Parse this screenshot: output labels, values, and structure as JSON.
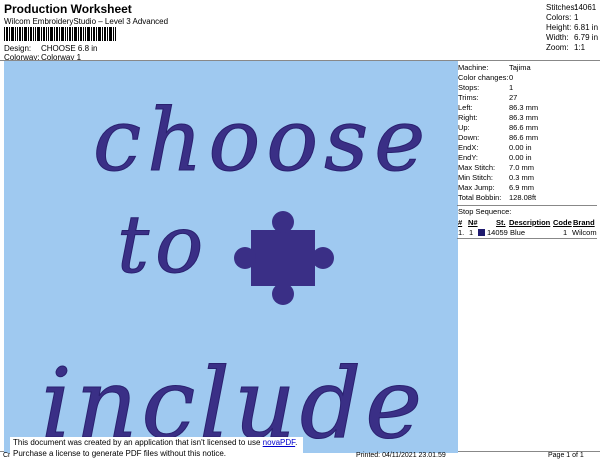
{
  "header": {
    "title": "Production Worksheet",
    "software": "Wilcom EmbroideryStudio – Level 3 Advanced",
    "design_label": "Design:",
    "design_value": "CHOOSE 6.8 in",
    "colorway_label": "Colorway:",
    "colorway_value": "Colorway 1"
  },
  "summary": [
    {
      "label": "Stitches:",
      "value": "14061"
    },
    {
      "label": "Colors:",
      "value": "1"
    },
    {
      "label": "Height:",
      "value": "6.81 in"
    },
    {
      "label": "Width:",
      "value": "6.79 in"
    },
    {
      "label": "Zoom:",
      "value": "1:1"
    }
  ],
  "design_text": {
    "line1": "choose",
    "line2": "to",
    "line3": "include"
  },
  "colors": {
    "canvas": "#9fc9f0",
    "thread": "#3a2f86"
  },
  "details": [
    {
      "label": "Machine:",
      "value": "Tajima"
    },
    {
      "label": "Color changes:",
      "value": "0"
    },
    {
      "label": "Stops:",
      "value": "1"
    },
    {
      "label": "Trims:",
      "value": "27"
    },
    {
      "label": "Left:",
      "value": "86.3 mm"
    },
    {
      "label": "Right:",
      "value": "86.3 mm"
    },
    {
      "label": "Up:",
      "value": "86.6 mm"
    },
    {
      "label": "Down:",
      "value": "86.6 mm"
    },
    {
      "label": "EndX:",
      "value": "0.00 in"
    },
    {
      "label": "EndY:",
      "value": "0.00 in"
    },
    {
      "label": "Max Stitch:",
      "value": "7.0 mm"
    },
    {
      "label": "Min Stitch:",
      "value": "0.3 mm"
    },
    {
      "label": "Max Jump:",
      "value": "6.9 mm"
    },
    {
      "label": "Total Bobbin:",
      "value": "128.08ft"
    }
  ],
  "stop_sequence": {
    "title": "Stop Sequence:",
    "headers": [
      "#",
      "N#",
      "St.",
      "Description",
      "Code",
      "Brand"
    ],
    "rows": [
      {
        "num": "1.",
        "n": "1",
        "st": "14059",
        "description": "Blue",
        "code": "1",
        "brand": "Wilcom"
      }
    ]
  },
  "footer": {
    "notice_line1": "This document was created by an application that isn't licensed to use ",
    "notice_link": "novaPDF",
    "notice_line1_end": ".",
    "notice_line2": "Purchase a license to generate PDF files without this notice.",
    "left_stub": "Cr",
    "printed": "Printed: 04/11/2021 23.01.59",
    "page": "Page 1 of 1"
  }
}
